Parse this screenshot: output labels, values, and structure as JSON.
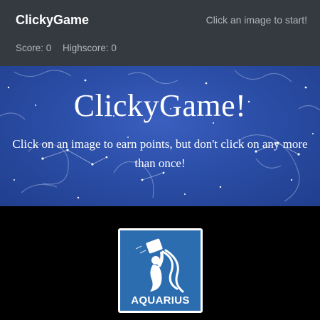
{
  "navbar": {
    "brand": "ClickyGame",
    "status": "Click an image to start!",
    "score": "Score: 0",
    "highscore": "Highscore: 0"
  },
  "hero": {
    "title": "ClickyGame!",
    "subtitle": "Click on an image to earn points, but don't click on any more than once!"
  },
  "cards": [
    {
      "label": "AQUARIUS",
      "icon": "aquarius-icon"
    }
  ],
  "colors": {
    "navbar_bg": "#343a40",
    "hero_bg": "#2b4ea7",
    "card_bg": "#2c6db0",
    "page_bg": "#000000"
  }
}
